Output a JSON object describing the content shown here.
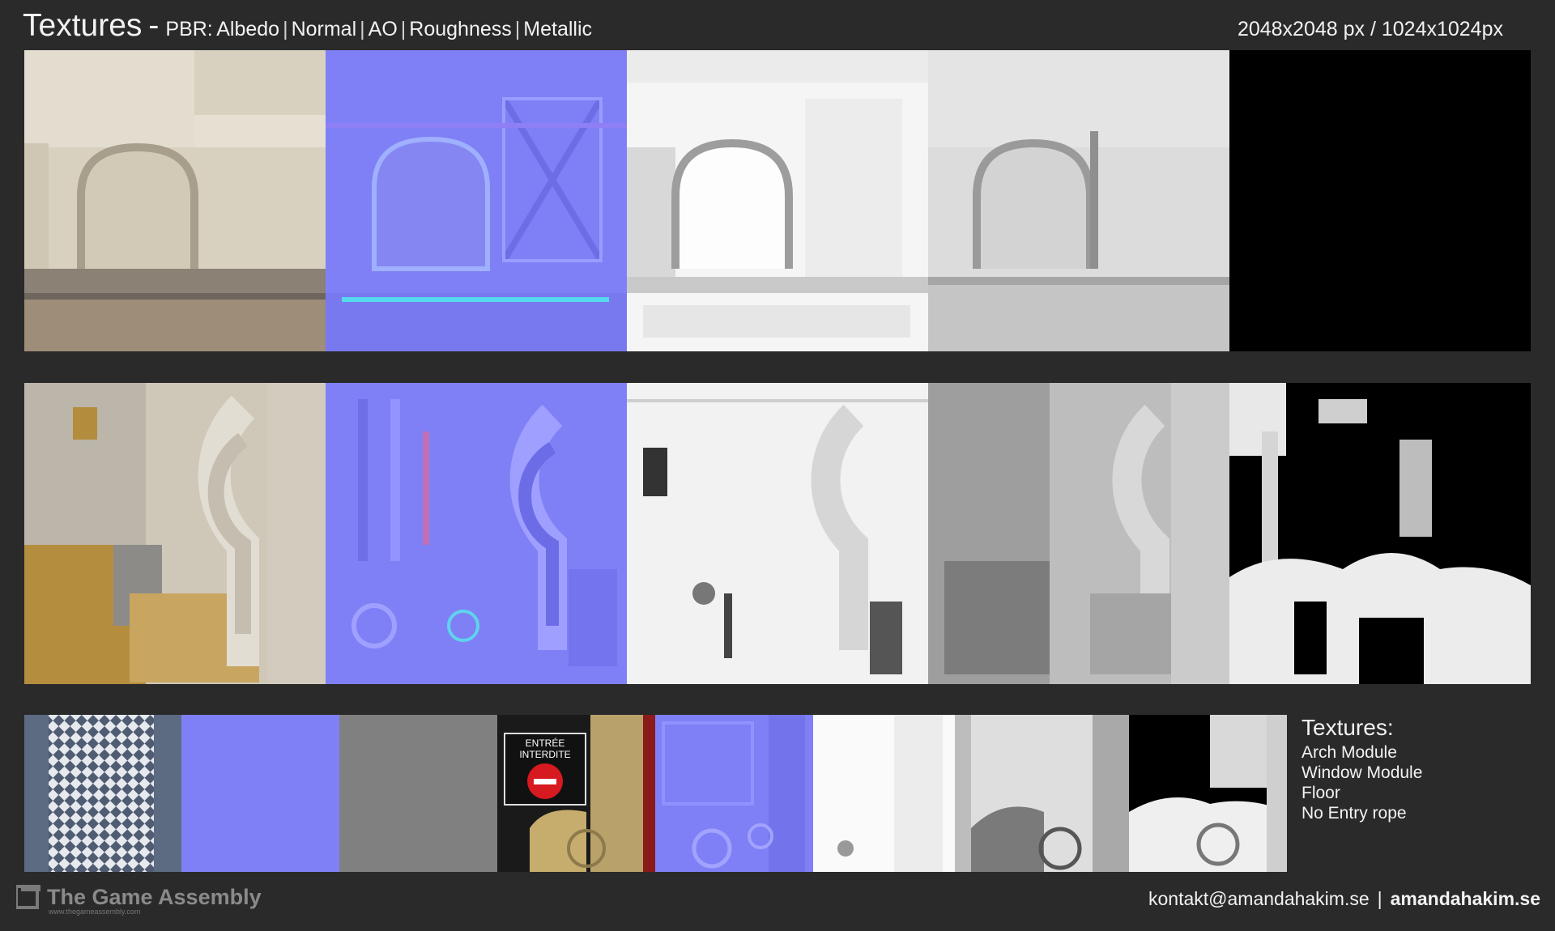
{
  "header": {
    "title": "Textures",
    "dash": "-",
    "pbr_label": "PBR:",
    "maps": [
      "Albedo",
      "Normal",
      "AO",
      "Roughness",
      "Metallic"
    ],
    "separator": "|",
    "resolution": "2048x2048 px / 1024x1024px"
  },
  "legend": {
    "heading": "Textures:",
    "items": [
      "Arch Module",
      "Window Module",
      "Floor",
      "No Entry rope"
    ]
  },
  "sign": {
    "line1": "ENTRÉE",
    "line2": "INTERDITE"
  },
  "footer": {
    "brand": "The Game Assembly",
    "brand_url": "www.thegameassembly.com",
    "email": "kontakt@amandahakim.se",
    "divider": "|",
    "website": "amandahakim.se"
  },
  "colors": {
    "background": "#2a2a2a",
    "albedo": "#d9d3c3",
    "normal": "#7f80f5",
    "ao": "#f4f4f4",
    "roughness": "#d9d9d9",
    "metallic": "#000000",
    "sign_red": "#d71920"
  }
}
